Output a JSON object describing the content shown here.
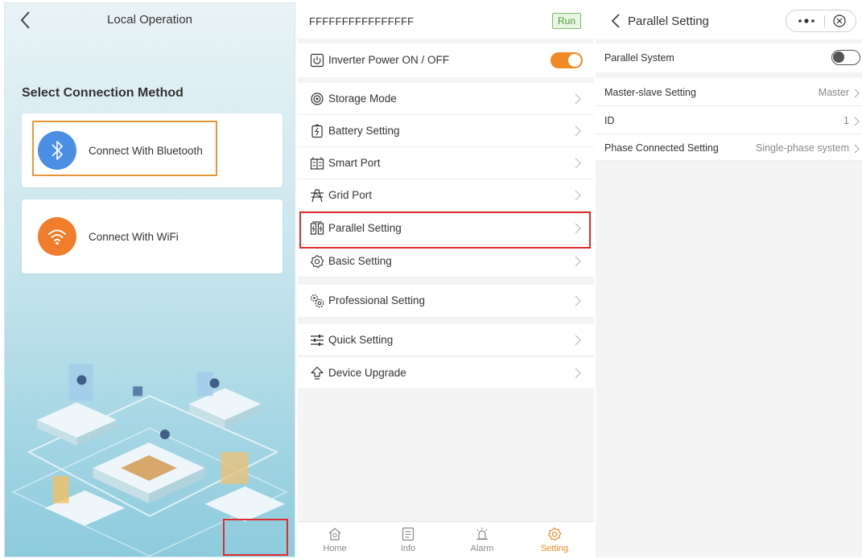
{
  "local_operation": {
    "title": "Local Operation",
    "section_title": "Select Connection Method",
    "options": [
      {
        "label": "Connect With Bluetooth",
        "icon": "bluetooth-icon",
        "color": "#4a8fe3"
      },
      {
        "label": "Connect With WiFi",
        "icon": "wifi-icon",
        "color": "#ef7d2c"
      }
    ]
  },
  "settings_menu": {
    "serial": "FFFFFFFFFFFFFFFF",
    "status": "Run",
    "power_label": "Inverter Power ON / OFF",
    "power_on": true,
    "items": [
      {
        "label": "Storage Mode",
        "icon": "storage-mode-icon"
      },
      {
        "label": "Battery Setting",
        "icon": "battery-icon"
      },
      {
        "label": "Smart Port",
        "icon": "smart-port-icon"
      },
      {
        "label": "Grid Port",
        "icon": "grid-port-icon"
      },
      {
        "label": "Parallel Setting",
        "icon": "parallel-icon"
      },
      {
        "label": "Basic Setting",
        "icon": "gear-icon"
      },
      {
        "label": "Professional Setting",
        "icon": "gears-icon"
      },
      {
        "label": "Quick Setting",
        "icon": "sliders-icon"
      },
      {
        "label": "Device Upgrade",
        "icon": "upgrade-icon"
      }
    ],
    "tabs": [
      {
        "label": "Home",
        "icon": "home-icon"
      },
      {
        "label": "Info",
        "icon": "info-icon"
      },
      {
        "label": "Alarm",
        "icon": "alarm-icon"
      },
      {
        "label": "Setting",
        "icon": "gear-icon",
        "active": true
      }
    ],
    "accent": "#f08a24"
  },
  "parallel_setting": {
    "title": "Parallel Setting",
    "rows": [
      {
        "label": "Parallel System",
        "toggle": false
      },
      {
        "label": "Master-slave Setting",
        "value": "Master"
      },
      {
        "label": "ID",
        "value": "1"
      },
      {
        "label": "Phase Connected Setting",
        "value": "Single-phase system"
      }
    ]
  },
  "highlight_color": "#e02c2c"
}
